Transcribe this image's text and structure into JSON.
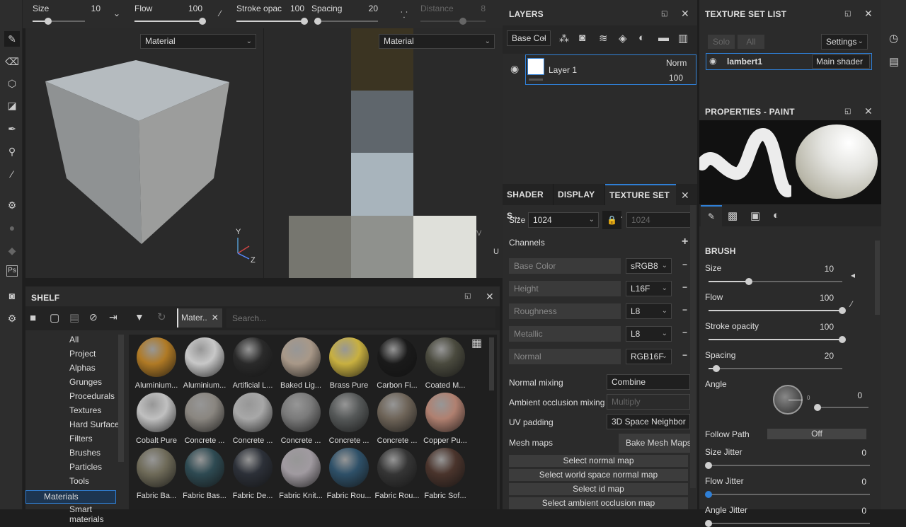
{
  "toolbar": {
    "size_label": "Size",
    "size_value": "10",
    "flow_label": "Flow",
    "flow_value": "100",
    "stroke_label": "Stroke opac",
    "stroke_value": "100",
    "spacing_label": "Spacing",
    "spacing_value": "20",
    "distance_label": "Distance",
    "distance_value": "8",
    "size_pct": 0.3,
    "flow_pct": 1.0,
    "stroke_pct": 1.0,
    "spacing_pct": 0.05
  },
  "viewport3d": {
    "channel": "Material",
    "axis_y": "Y",
    "axis_z": "Z"
  },
  "viewport2d": {
    "channel": "Material",
    "axis_u": "U",
    "axis_v": "V"
  },
  "layers": {
    "title": "LAYERS",
    "channel": "Base Col",
    "layer_name": "Layer 1",
    "blend": "Norm",
    "opacity": "100"
  },
  "texture_set_list": {
    "title": "TEXTURE SET LIST",
    "solo": "Solo",
    "all": "All",
    "settings": "Settings",
    "set_name": "lambert1",
    "shader": "Main shader"
  },
  "settings_tabs": [
    "SHADER S...",
    "DISPLAY S...",
    "TEXTURE SET S..."
  ],
  "texture_set": {
    "size_label": "Size",
    "size": "1024",
    "size_locked": "1024",
    "channels_label": "Channels",
    "channels": [
      {
        "name": "Base Color",
        "format": "sRGB8"
      },
      {
        "name": "Height",
        "format": "L16F"
      },
      {
        "name": "Roughness",
        "format": "L8"
      },
      {
        "name": "Metallic",
        "format": "L8"
      },
      {
        "name": "Normal",
        "format": "RGB16F"
      }
    ],
    "normal_mixing_label": "Normal mixing",
    "normal_mixing": "Combine",
    "ao_mixing_label": "Ambient occlusion mixing",
    "ao_mixing": "Multiply",
    "uv_padding_label": "UV padding",
    "uv_padding": "3D Space Neighbor",
    "mesh_maps_label": "Mesh maps",
    "bake_button": "Bake Mesh Maps",
    "map_buttons": [
      "Select normal map",
      "Select world space normal map",
      "Select id map",
      "Select ambient occlusion map"
    ]
  },
  "properties": {
    "title": "PROPERTIES - PAINT",
    "section": "BRUSH",
    "size_label": "Size",
    "size": "10",
    "size_pct": 0.3,
    "flow_label": "Flow",
    "flow": "100",
    "flow_pct": 1.0,
    "stroke_label": "Stroke opacity",
    "stroke": "100",
    "stroke_pct": 1.0,
    "spacing_label": "Spacing",
    "spacing": "20",
    "spacing_pct": 0.06,
    "angle_label": "Angle",
    "angle": "0",
    "angle_dial": "0",
    "follow_path_label": "Follow Path",
    "follow_path": "Off",
    "size_jitter_label": "Size Jitter",
    "size_jitter": "0",
    "flow_jitter_label": "Flow Jitter",
    "flow_jitter": "0",
    "angle_jitter_label": "Angle Jitter",
    "angle_jitter": "0"
  },
  "shelf": {
    "title": "SHELF",
    "filter_tag": "Mater..",
    "search_placeholder": "Search...",
    "categories": [
      "All",
      "Project",
      "Alphas",
      "Grunges",
      "Procedurals",
      "Textures",
      "Hard Surfaces",
      "Filters",
      "Brushes",
      "Particles",
      "Tools",
      "Materials",
      "Smart materials"
    ],
    "selected_category": "Materials",
    "materials": [
      {
        "name": "Aluminium...",
        "color": "#b07a25"
      },
      {
        "name": "Aluminium...",
        "color": "#c8c8c8"
      },
      {
        "name": "Artificial L...",
        "color": "#2a2a2a"
      },
      {
        "name": "Baked Lig...",
        "color": "#a89888"
      },
      {
        "name": "Brass Pure",
        "color": "#c8b040"
      },
      {
        "name": "Carbon Fi...",
        "color": "#1a1a1a"
      },
      {
        "name": "Coated M...",
        "color": "#4a4a3e"
      },
      {
        "name": "Cobalt Pure",
        "color": "#c0c0c0"
      },
      {
        "name": "Concrete ...",
        "color": "#8a8680"
      },
      {
        "name": "Concrete ...",
        "color": "#a8a8a8"
      },
      {
        "name": "Concrete ...",
        "color": "#7a7a7a"
      },
      {
        "name": "Concrete ...",
        "color": "#555858"
      },
      {
        "name": "Concrete ...",
        "color": "#6e6458"
      },
      {
        "name": "Copper Pu...",
        "color": "#b08070"
      },
      {
        "name": "Fabric Ba...",
        "color": "#6e6a58"
      },
      {
        "name": "Fabric Bas...",
        "color": "#2e4a52"
      },
      {
        "name": "Fabric De...",
        "color": "#2c3038"
      },
      {
        "name": "Fabric Knit...",
        "color": "#a09aa0"
      },
      {
        "name": "Fabric Rou...",
        "color": "#2e5068"
      },
      {
        "name": "Fabric Rou...",
        "color": "#353535"
      },
      {
        "name": "Fabric Sof...",
        "color": "#4a342c"
      }
    ]
  },
  "colors": {
    "accent": "#2f7fd6",
    "panel": "#2b2b2b",
    "selection": "#1d5fa8"
  }
}
